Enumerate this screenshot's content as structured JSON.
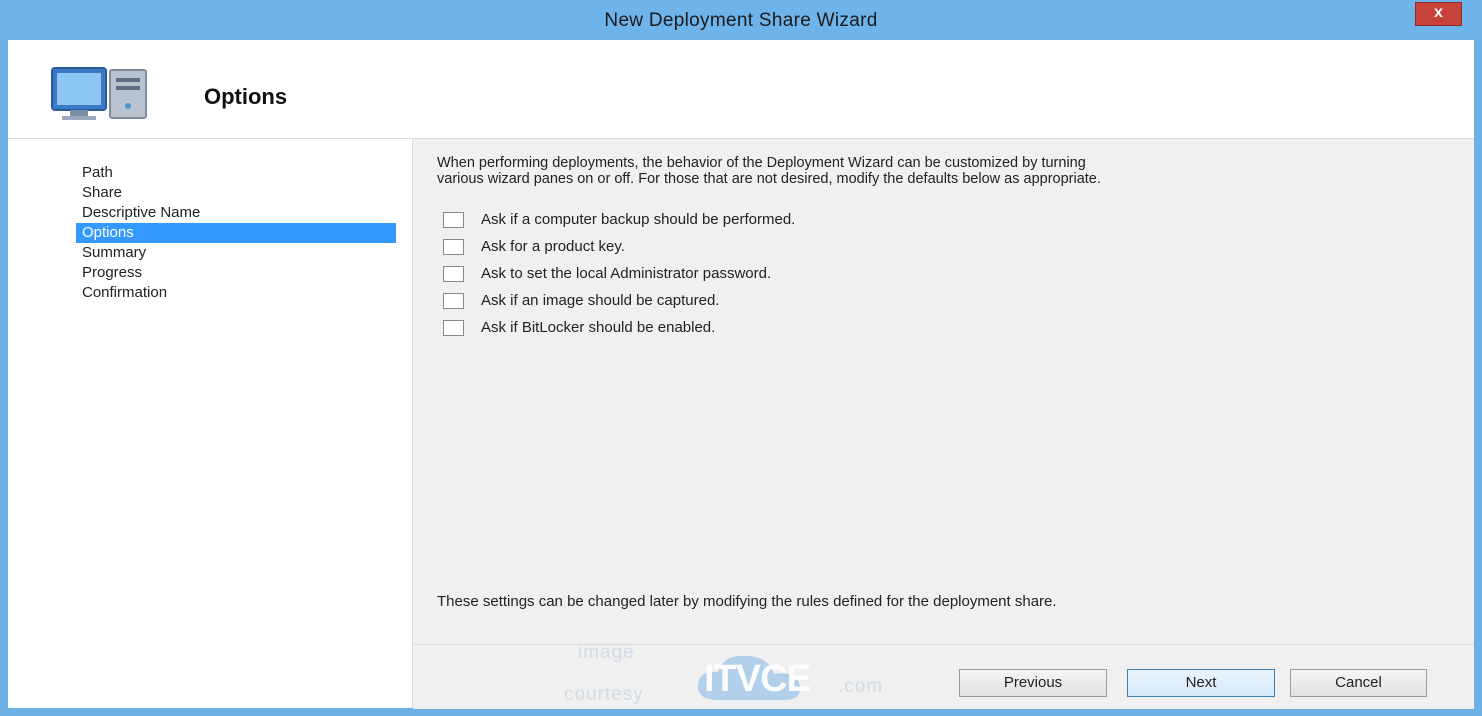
{
  "window": {
    "title": "New Deployment Share Wizard",
    "close_label": "x"
  },
  "header": {
    "title": "Options",
    "icon": "computer-wizard-icon"
  },
  "sidebar": {
    "items": [
      {
        "label": "Path"
      },
      {
        "label": "Share"
      },
      {
        "label": "Descriptive Name"
      },
      {
        "label": "Options",
        "selected": true
      },
      {
        "label": "Summary"
      },
      {
        "label": "Progress"
      },
      {
        "label": "Confirmation"
      }
    ]
  },
  "main": {
    "intro_line1": "When performing deployments, the behavior of the Deployment Wizard can be customized by turning",
    "intro_line2": "various wizard panes on or off.  For those that are not desired, modify the defaults below as appropriate.",
    "options": [
      {
        "label": "Ask if a computer backup should be performed.",
        "checked": false
      },
      {
        "label": "Ask for a product key.",
        "checked": false
      },
      {
        "label": "Ask to set the local Administrator password.",
        "checked": false
      },
      {
        "label": "Ask if an image should be captured.",
        "checked": false
      },
      {
        "label": "Ask if BitLocker should be enabled.",
        "checked": false
      }
    ],
    "footer_note": "These settings can be changed later by modifying the rules defined for the deployment share."
  },
  "buttons": {
    "previous": "Previous",
    "next": "Next",
    "cancel": "Cancel"
  },
  "watermark": {
    "line1": "image",
    "line2": "courtesy",
    "brand": "ITVCE",
    "suffix": ".com"
  },
  "colors": {
    "title_bar": "#6eb3ea",
    "selection": "#3399ff",
    "close": "#c7423a"
  }
}
